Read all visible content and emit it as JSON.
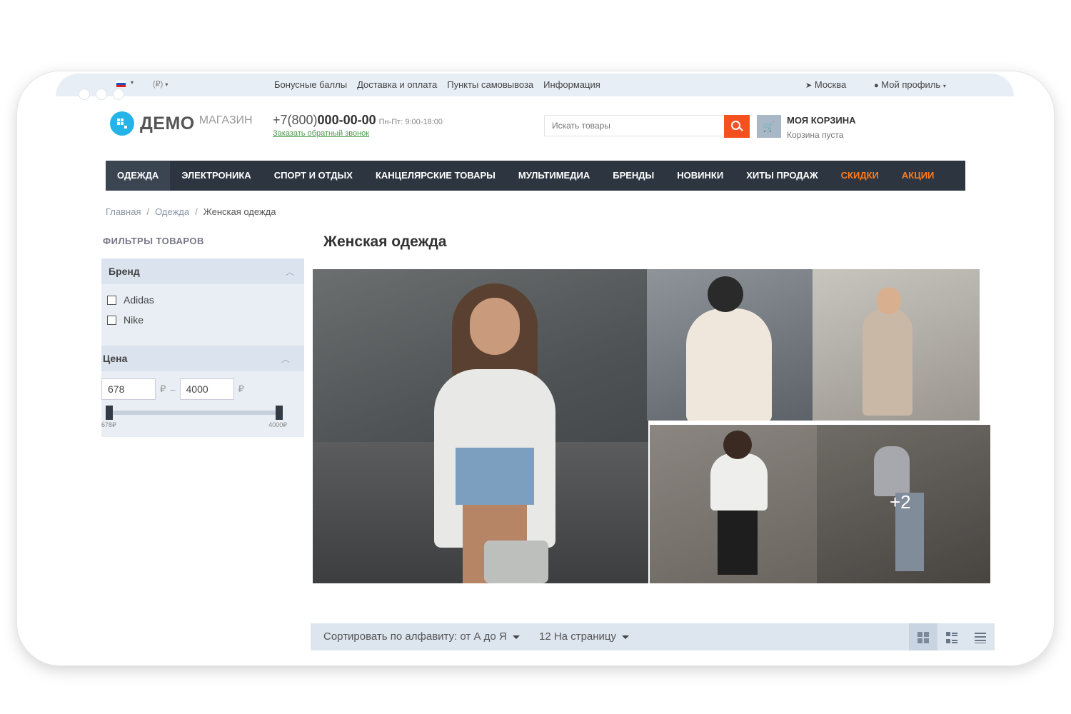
{
  "topbar": {
    "currency": "(₽)",
    "links": [
      "Бонусные баллы",
      "Доставка и оплата",
      "Пункты самовывоза",
      "Информация"
    ],
    "city": "Москва",
    "profile": "Мой профиль"
  },
  "logo": {
    "demo": "ДЕМО",
    "shop": "МАГАЗИН"
  },
  "phone": {
    "prefix": "+7(800)",
    "number": "000-00-00",
    "hours": "Пн-Пт: 9:00-18:00",
    "callback": "Заказать обратный звонок"
  },
  "search": {
    "placeholder": "Искать товары"
  },
  "cart": {
    "title": "МОЯ КОРЗИНА",
    "status": "Корзина пуста"
  },
  "nav": {
    "items": [
      "ОДЕЖДА",
      "ЭЛЕКТРОНИКА",
      "СПОРТ И ОТДЫХ",
      "КАНЦЕЛЯРСКИЕ ТОВАРЫ",
      "МУЛЬТИМЕДИА",
      "БРЕНДЫ",
      "НОВИНКИ",
      "ХИТЫ ПРОДАЖ",
      "СКИДКИ",
      "АКЦИИ"
    ],
    "accent_color": "#ff7a1a"
  },
  "breadcrumb": {
    "home": "Главная",
    "section": "Одежда",
    "current": "Женская одежда"
  },
  "filters": {
    "title": "ФИЛЬТРЫ ТОВАРОВ",
    "brand": {
      "title": "Бренд",
      "options": [
        "Adidas",
        "Nike"
      ]
    },
    "price": {
      "title": "Цена",
      "min": "678",
      "max": "4000",
      "currency": "₽",
      "dash": "–",
      "range_min_label": "678₽",
      "range_max_label": "4000₽"
    }
  },
  "main": {
    "title": "Женская одежда",
    "more_photos": "+2"
  },
  "sortbar": {
    "sort_label": "Сортировать по алфавиту: от А до Я",
    "per_page_label": "12 На страницу"
  },
  "colors": {
    "search_button": "#f4511e",
    "nav_bg": "#2d3540",
    "logo": "#24b4e8"
  }
}
